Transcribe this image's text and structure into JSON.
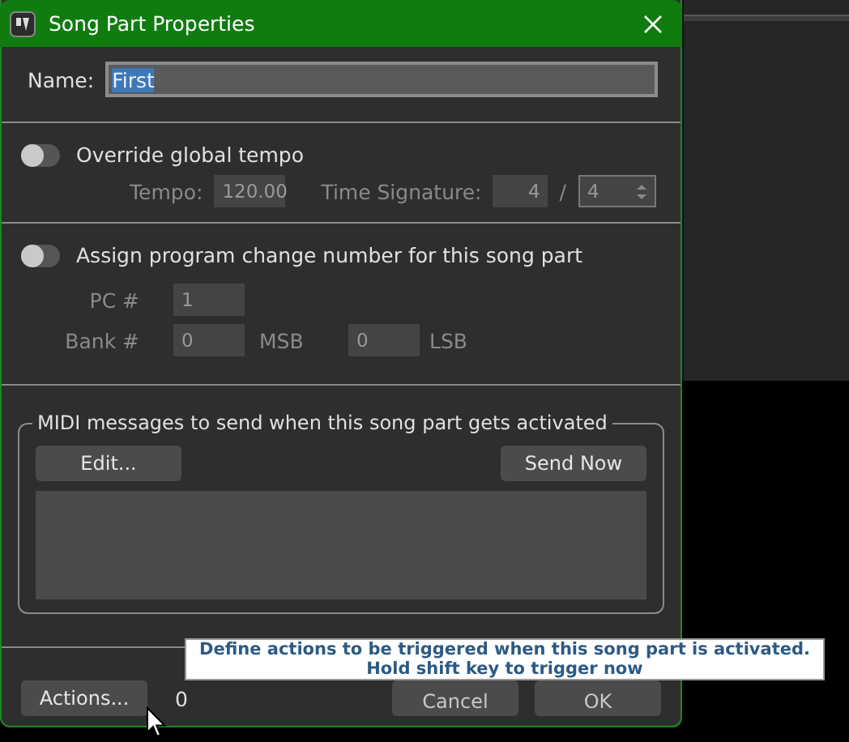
{
  "window": {
    "title": "Song Part Properties"
  },
  "name": {
    "label": "Name:",
    "value": "First",
    "text_selected": true
  },
  "override_tempo": {
    "label": "Override global tempo",
    "on": false,
    "disabled": true,
    "tempo_label": "Tempo:",
    "tempo": "120.00",
    "time_signature_label": "Time Signature:",
    "numerator": "4",
    "separator": "/",
    "denominator": "4"
  },
  "program_change": {
    "label": "Assign program change number for this song part",
    "on": false,
    "disabled": true,
    "pc_label": "PC #",
    "pc": "1",
    "bank_label": "Bank #",
    "msb": "0",
    "msb_label": "MSB",
    "lsb": "0",
    "lsb_label": "LSB"
  },
  "midi_messages": {
    "title": "MIDI messages to send when this song part gets activated",
    "edit_button": "Edit...",
    "send_button": "Send Now"
  },
  "footer": {
    "actions_button": "Actions...",
    "actions_count": "0",
    "cancel_button": "Cancel",
    "ok_button": "OK"
  },
  "tooltip": {
    "lines": [
      "Define actions to be triggered when this song part is activated.",
      "Hold shift key to trigger now"
    ]
  }
}
